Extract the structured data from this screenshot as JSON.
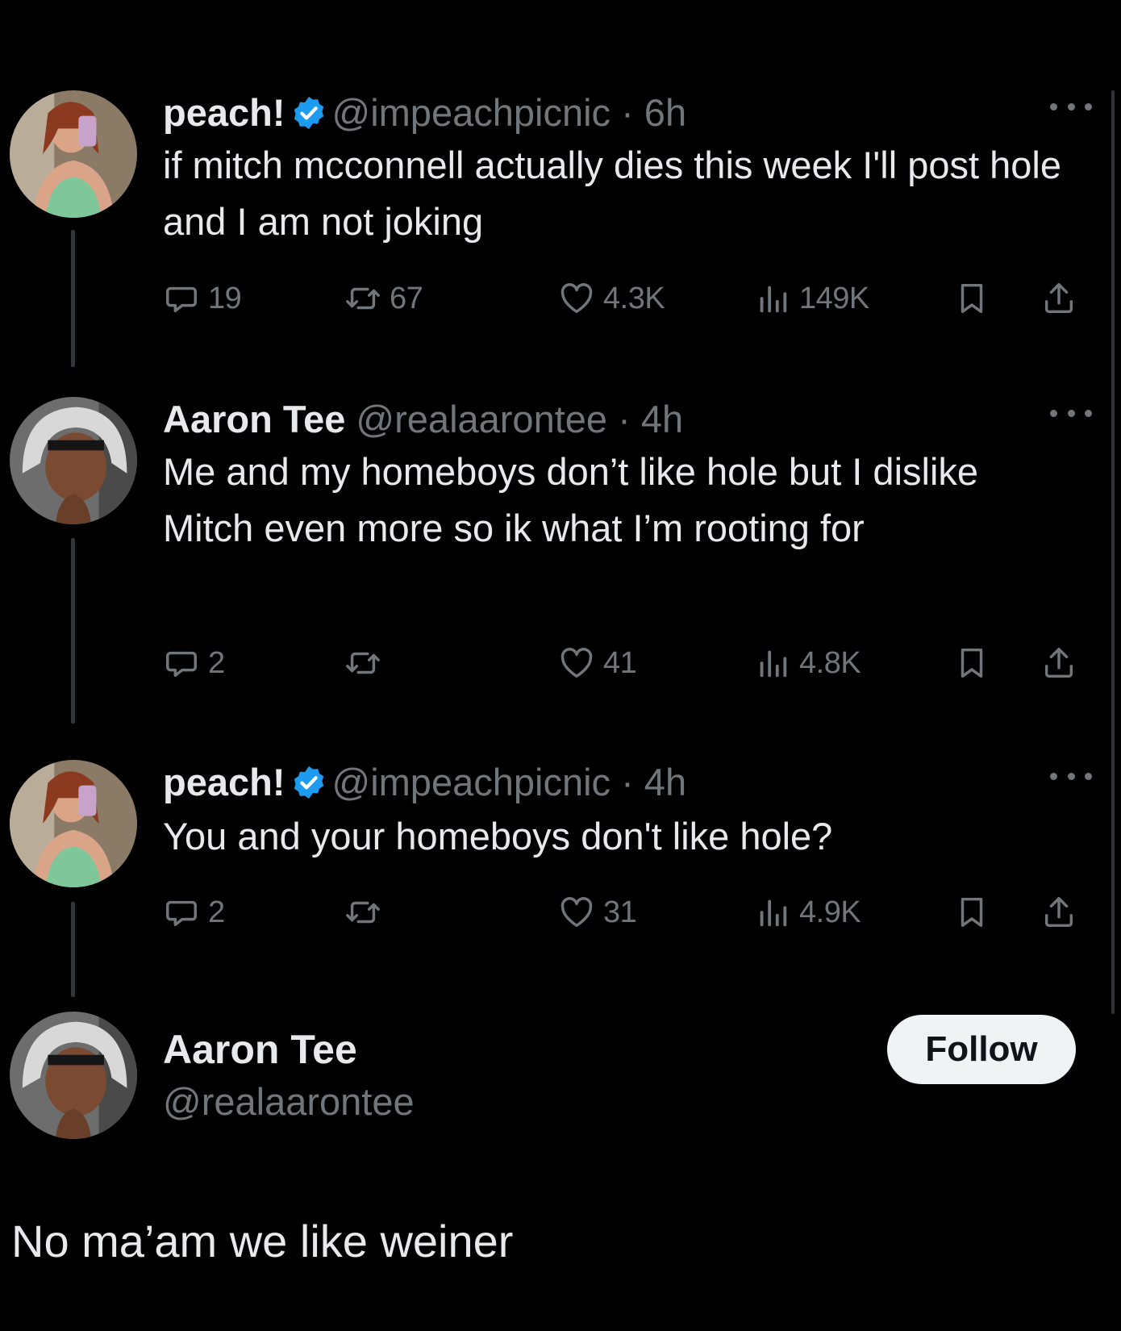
{
  "tweets": [
    {
      "name": "peach!",
      "verified": true,
      "handle": "@impeachpicnic",
      "time": "· 6h",
      "text": "if mitch mcconnell actually dies this week I'll post hole and I am not joking",
      "replies": "19",
      "retweets": "67",
      "likes": "4.3K",
      "views": "149K"
    },
    {
      "name": "Aaron Tee",
      "verified": false,
      "handle": "@realaarontee",
      "time": "· 4h",
      "text": "Me and my homeboys don’t like hole but I dislike Mitch even more so ik what I’m rooting for",
      "replies": "2",
      "retweets": "",
      "likes": "41",
      "views": "4.8K"
    },
    {
      "name": "peach!",
      "verified": true,
      "handle": "@impeachpicnic",
      "time": "· 4h",
      "text": "You and your homeboys don't like hole?",
      "replies": "2",
      "retweets": "",
      "likes": "31",
      "views": "4.9K"
    }
  ],
  "profile": {
    "name": "Aaron Tee",
    "handle": "@realaarontee",
    "follow_label": "Follow"
  },
  "reply_text": "No ma’am we like weiner",
  "icons": {
    "reply": "speech-bubble-icon",
    "retweet": "retweet-icon",
    "like": "heart-icon",
    "views": "bar-chart-icon",
    "bookmark": "bookmark-icon",
    "share": "share-icon",
    "verified": "verified-badge-icon",
    "more": "more-dots-icon"
  },
  "colors": {
    "background": "#000000",
    "text": "#e7e9ea",
    "muted": "#71767b",
    "verified": "#1d9bf0",
    "follow_bg": "#eff3f4"
  }
}
